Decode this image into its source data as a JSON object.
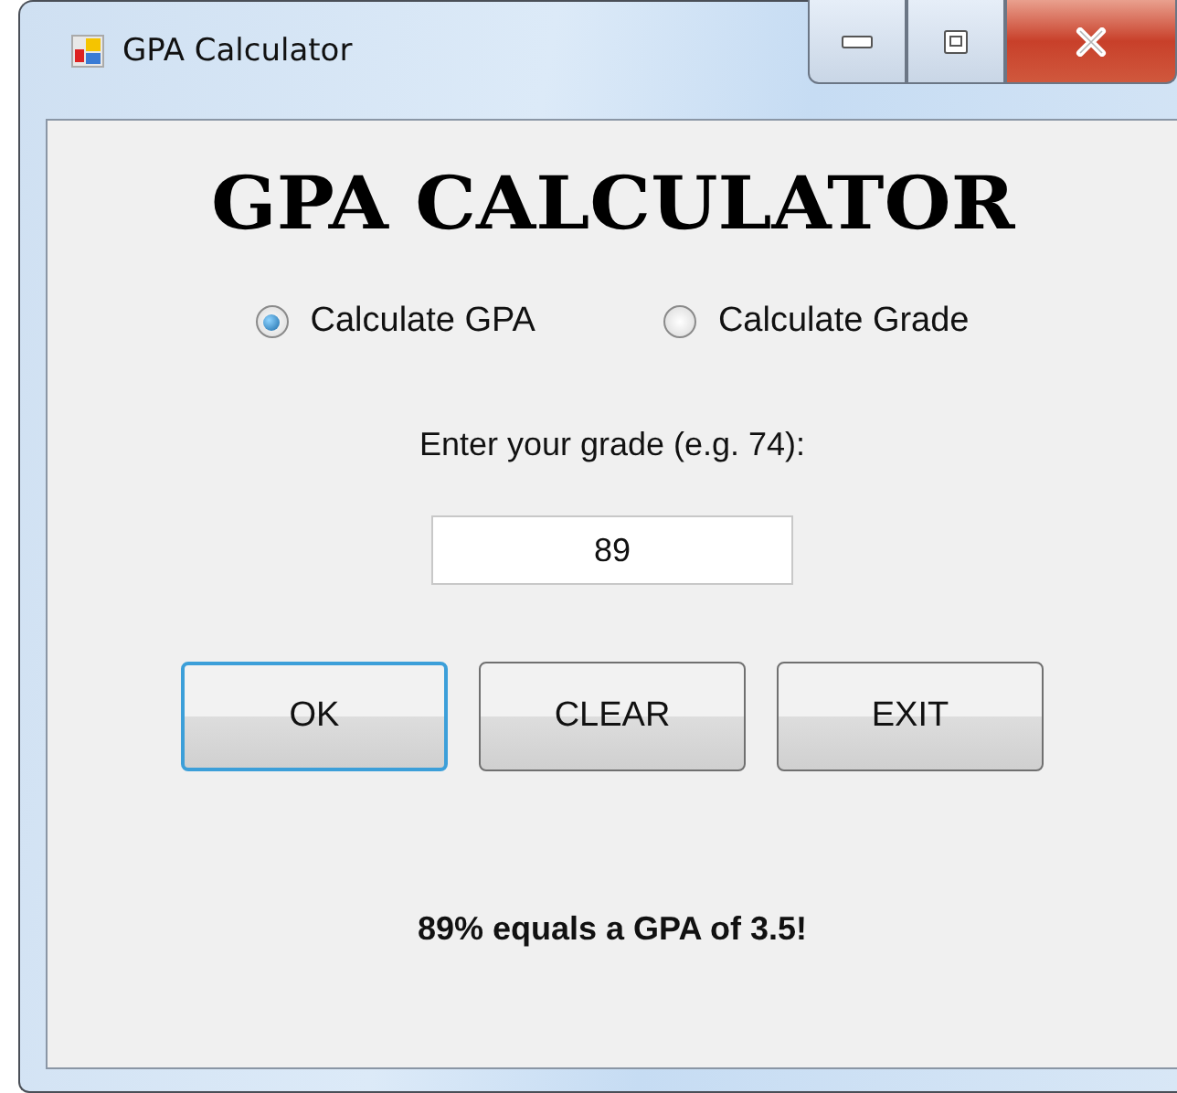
{
  "window": {
    "title": "GPA Calculator"
  },
  "heading": "GPA CALCULATOR",
  "modes": [
    {
      "label": "Calculate GPA",
      "selected": true
    },
    {
      "label": "Calculate Grade",
      "selected": false
    }
  ],
  "prompt": "Enter your grade (e.g. 74):",
  "grade_field": {
    "value": "89"
  },
  "buttons": [
    {
      "label": "OK",
      "focused": true
    },
    {
      "label": "CLEAR",
      "focused": false
    },
    {
      "label": "EXIT",
      "focused": false
    }
  ],
  "result": "89% equals a GPA of 3.5!"
}
